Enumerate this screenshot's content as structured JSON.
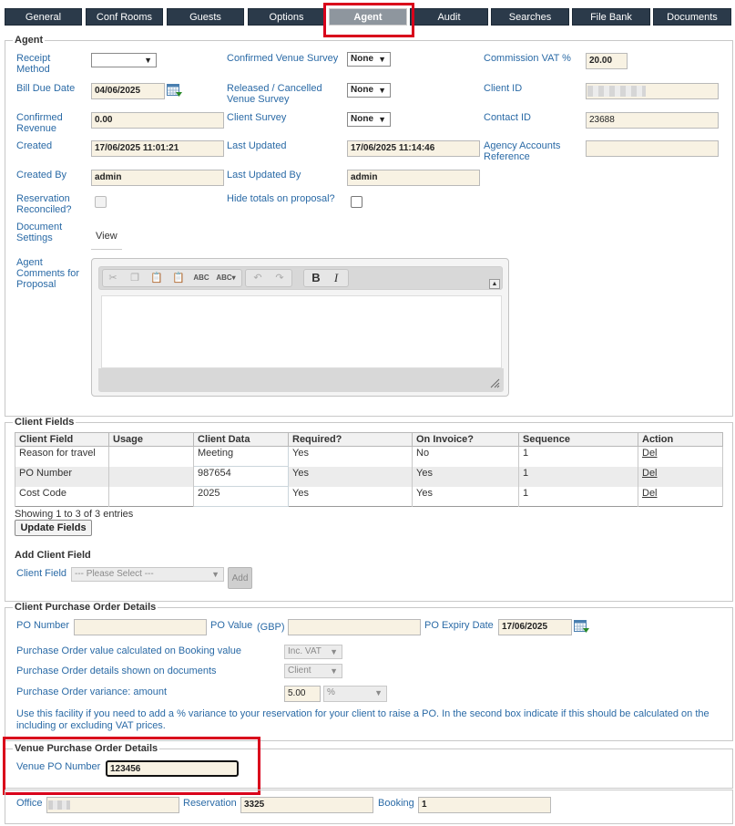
{
  "tabs": [
    {
      "label": "General"
    },
    {
      "label": "Conf Rooms"
    },
    {
      "label": "Guests"
    },
    {
      "label": "Options"
    },
    {
      "label": "Agent"
    },
    {
      "label": "Audit"
    },
    {
      "label": "Searches"
    },
    {
      "label": "File Bank"
    },
    {
      "label": "Documents"
    }
  ],
  "agent": {
    "legend": "Agent",
    "receipt_method_label": "Receipt Method",
    "receipt_method_value": "",
    "confirmed_venue_survey_label": "Confirmed Venue Survey",
    "confirmed_venue_survey_value": "None",
    "commission_vat_label": "Commission VAT %",
    "commission_vat_value": "20.00",
    "bill_due_date_label": "Bill Due Date",
    "bill_due_date_value": "04/06/2025",
    "released_cancelled_label": "Released / Cancelled Venue Survey",
    "released_cancelled_value": "None",
    "client_id_label": "Client ID",
    "client_id_value": "",
    "confirmed_revenue_label": "Confirmed Revenue",
    "confirmed_revenue_value": "0.00",
    "client_survey_label": "Client Survey",
    "client_survey_value": "None",
    "contact_id_label": "Contact ID",
    "contact_id_value": "23688",
    "created_label": "Created",
    "created_value": "17/06/2025 11:01:21",
    "last_updated_label": "Last Updated",
    "last_updated_value": "17/06/2025 11:14:46",
    "agency_accounts_label": "Agency Accounts Reference",
    "agency_accounts_value": "",
    "created_by_label": "Created By",
    "created_by_value": "admin",
    "last_updated_by_label": "Last Updated By",
    "last_updated_by_value": "admin",
    "reservation_reconciled_label": "Reservation Reconciled?",
    "hide_totals_label": "Hide totals on proposal?",
    "document_settings_label": "Document Settings",
    "document_settings_link": "View",
    "agent_comments_label": "Agent Comments for Proposal"
  },
  "editor": {
    "bold": "B",
    "italic": "I"
  },
  "client_fields": {
    "legend": "Client Fields",
    "headers": [
      "Client Field",
      "Usage",
      "Client Data",
      "Required?",
      "On Invoice?",
      "Sequence",
      "Action"
    ],
    "rows": [
      {
        "field": "Reason for travel",
        "usage": "",
        "data": "Meeting",
        "required": "Yes",
        "invoice": "No",
        "sequence": "1",
        "action": "Del"
      },
      {
        "field": "PO Number",
        "usage": "",
        "data": "987654",
        "required": "Yes",
        "invoice": "Yes",
        "sequence": "1",
        "action": "Del"
      },
      {
        "field": "Cost Code",
        "usage": "",
        "data": "2025",
        "required": "Yes",
        "invoice": "Yes",
        "sequence": "1",
        "action": "Del"
      }
    ],
    "showing": "Showing 1 to 3 of 3 entries",
    "update_button": "Update Fields",
    "add_heading": "Add Client Field",
    "client_field_label": "Client Field",
    "client_field_placeholder": "--- Please Select ---",
    "add_button": "Add"
  },
  "client_po": {
    "legend": "Client Purchase Order Details",
    "po_number_label": "PO Number",
    "po_number_value": "",
    "po_value_label": "PO Value",
    "po_value_currency": "(GBP)",
    "po_value_value": "",
    "po_expiry_label": "PO Expiry Date",
    "po_expiry_value": "17/06/2025",
    "calc_label": "Purchase Order value calculated on Booking value",
    "calc_value": "Inc. VAT",
    "shown_label": "Purchase Order details shown on documents",
    "shown_value": "Client",
    "variance_label": "Purchase Order variance: amount",
    "variance_value": "5.00",
    "variance_unit": "%",
    "help_text": "Use this facility if you need to add a % variance to your reservation for your client to raise a PO. In the second box indicate if this should be calculated on the including or excluding VAT prices."
  },
  "venue_po": {
    "legend": "Venue Purchase Order Details",
    "venue_po_label": "Venue PO Number",
    "venue_po_value": "123456"
  },
  "footer": {
    "office_label": "Office",
    "office_value": "",
    "reservation_label": "Reservation",
    "reservation_value": "3325",
    "booking_label": "Booking",
    "booking_value": "1"
  },
  "colors": {
    "tab_bg": "#2b3a4a",
    "tab_active_bg": "#8e969e",
    "label_blue": "#2a6aa6",
    "input_bg": "#f8f2e3",
    "highlight_red": "#d9001b"
  }
}
